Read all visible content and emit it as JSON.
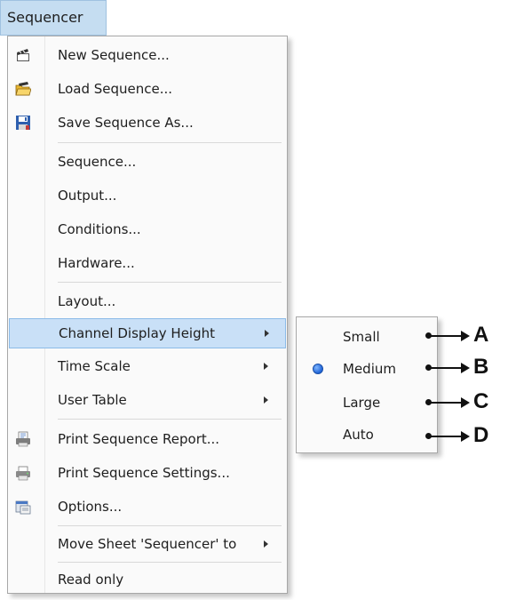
{
  "menubar": {
    "title": "Sequencer"
  },
  "menu": {
    "items": [
      {
        "label": "New Sequence...",
        "icon": "clapper-new-icon"
      },
      {
        "label": "Load Sequence...",
        "icon": "open-folder-icon"
      },
      {
        "label": "Save Sequence As...",
        "icon": "floppy-disk-icon"
      },
      {
        "label": "Sequence..."
      },
      {
        "label": "Output..."
      },
      {
        "label": "Conditions..."
      },
      {
        "label": "Hardware..."
      },
      {
        "label": "Layout..."
      },
      {
        "label": "Channel Display Height",
        "submenu": true,
        "highlighted": true
      },
      {
        "label": "Time Scale",
        "submenu": true
      },
      {
        "label": "User Table",
        "submenu": true
      },
      {
        "label": "Print Sequence Report...",
        "icon": "print-report-icon"
      },
      {
        "label": "Print Sequence Settings...",
        "icon": "printer-icon"
      },
      {
        "label": "Options...",
        "icon": "options-icon"
      },
      {
        "label": "Move Sheet 'Sequencer' to",
        "submenu": true
      },
      {
        "label": "Read only"
      }
    ]
  },
  "submenu": {
    "items": [
      {
        "label": "Small",
        "selected": false,
        "callout": "A"
      },
      {
        "label": "Medium",
        "selected": true,
        "callout": "B"
      },
      {
        "label": "Large",
        "selected": false,
        "callout": "C"
      },
      {
        "label": "Auto",
        "selected": false,
        "callout": "D"
      }
    ]
  },
  "colors": {
    "highlight": "#c9e0f7",
    "menubar": "#c5ddf1",
    "radio": "#1f63d6"
  }
}
